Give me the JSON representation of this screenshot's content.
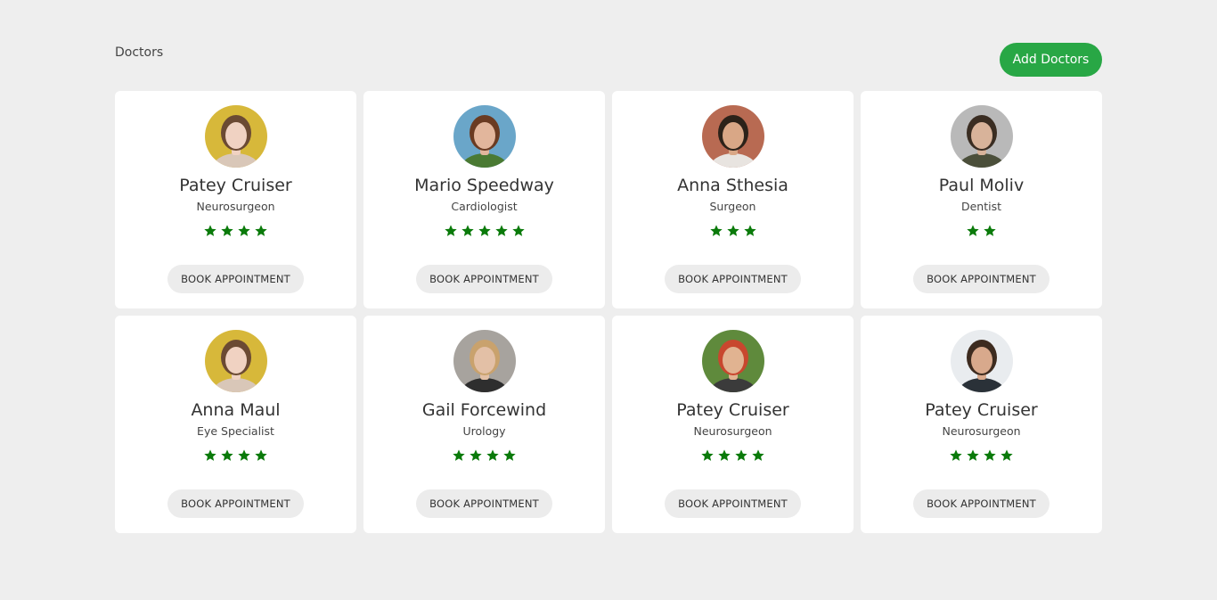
{
  "header": {
    "title": "Doctors",
    "add_button_label": "Add Doctors"
  },
  "colors": {
    "accent": "#28a745",
    "star": "#0a7a0a",
    "background": "#eeeeee",
    "card": "#ffffff"
  },
  "doctors": [
    {
      "name": "Patey Cruiser",
      "specialty": "Neurosurgeon",
      "rating": 4,
      "button_label": "BOOK APPOINTMENT",
      "avatar": {
        "bg": "#d7b83a",
        "skin": "#f0d2c2",
        "hair": "#6b4a33",
        "shirt": "#d9c7b8"
      }
    },
    {
      "name": "Mario Speedway",
      "specialty": "Cardiologist",
      "rating": 5,
      "button_label": "BOOK APPOINTMENT",
      "avatar": {
        "bg": "#6aa6c9",
        "skin": "#e2b69c",
        "hair": "#6a3b22",
        "shirt": "#4a7a33"
      }
    },
    {
      "name": "Anna Sthesia",
      "specialty": "Surgeon",
      "rating": 3,
      "button_label": "BOOK APPOINTMENT",
      "avatar": {
        "bg": "#b86a52",
        "skin": "#d9a786",
        "hair": "#2c2219",
        "shirt": "#e8e4e0"
      }
    },
    {
      "name": "Paul Moliv",
      "specialty": "Dentist",
      "rating": 2,
      "button_label": "BOOK APPOINTMENT",
      "avatar": {
        "bg": "#b9b9b9",
        "skin": "#d8b39a",
        "hair": "#3a2d22",
        "shirt": "#4b4f3a"
      }
    },
    {
      "name": "Anna Maul",
      "specialty": "Eye Specialist",
      "rating": 4,
      "button_label": "BOOK APPOINTMENT",
      "avatar": {
        "bg": "#d7b83a",
        "skin": "#f0d2c2",
        "hair": "#6b4a33",
        "shirt": "#d9c7b8"
      }
    },
    {
      "name": "Gail Forcewind",
      "specialty": "Urology",
      "rating": 4,
      "button_label": "BOOK APPOINTMENT",
      "avatar": {
        "bg": "#a7a39e",
        "skin": "#e3c0a6",
        "hair": "#c9a26d",
        "shirt": "#2e2e2e"
      }
    },
    {
      "name": "Patey Cruiser",
      "specialty": "Neurosurgeon",
      "rating": 4,
      "button_label": "BOOK APPOINTMENT",
      "avatar": {
        "bg": "#5f8a3c",
        "skin": "#e1b391",
        "hair": "#c8472e",
        "shirt": "#3b3b3b"
      }
    },
    {
      "name": "Patey Cruiser",
      "specialty": "Neurosurgeon",
      "rating": 4,
      "button_label": "BOOK APPOINTMENT",
      "avatar": {
        "bg": "#e9ecef",
        "skin": "#d8a98c",
        "hair": "#3d2b1f",
        "shirt": "#2a3138"
      }
    }
  ]
}
